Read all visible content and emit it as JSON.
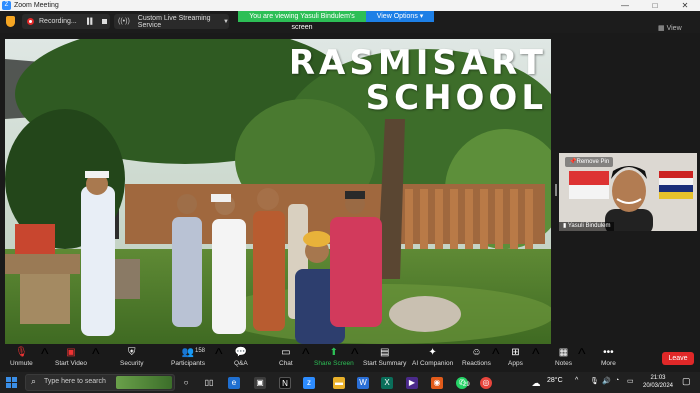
{
  "window": {
    "title": "Zoom Meeting",
    "controls": [
      "—",
      "□",
      "✕"
    ]
  },
  "topbar": {
    "recording_label": "Recording...",
    "live_label": "Custom Live Streaming Service",
    "viewing_banner": "You are viewing Yasuli Bindulem's screen",
    "view_options": "View Options",
    "view_label": "View"
  },
  "share": {
    "title_line1": "RASMISART",
    "title_line2": "SCHOOL"
  },
  "participant": {
    "pin_label": "Remove Pin",
    "name": "Yasuli Bindulem"
  },
  "toolbar": {
    "unmute": "Unmute",
    "start_video": "Start Video",
    "security": "Security",
    "participants": "Participants",
    "participants_count": "158",
    "qa": "Q&A",
    "chat": "Chat",
    "share_screen": "Share Screen",
    "start_summary": "Start Summary",
    "ai_companion": "AI Companion",
    "reactions": "Reactions",
    "apps": "Apps",
    "notes": "Notes",
    "more": "More",
    "leave": "Leave"
  },
  "taskbar": {
    "search_placeholder": "Type here to search",
    "whatsapp_badge": "29",
    "temperature": "28°C",
    "time": "21:03",
    "date": "20/03/2024"
  },
  "colors": {
    "accent_green": "#2dbf56",
    "accent_blue": "#1d7fe6",
    "leave_red": "#e02828"
  }
}
